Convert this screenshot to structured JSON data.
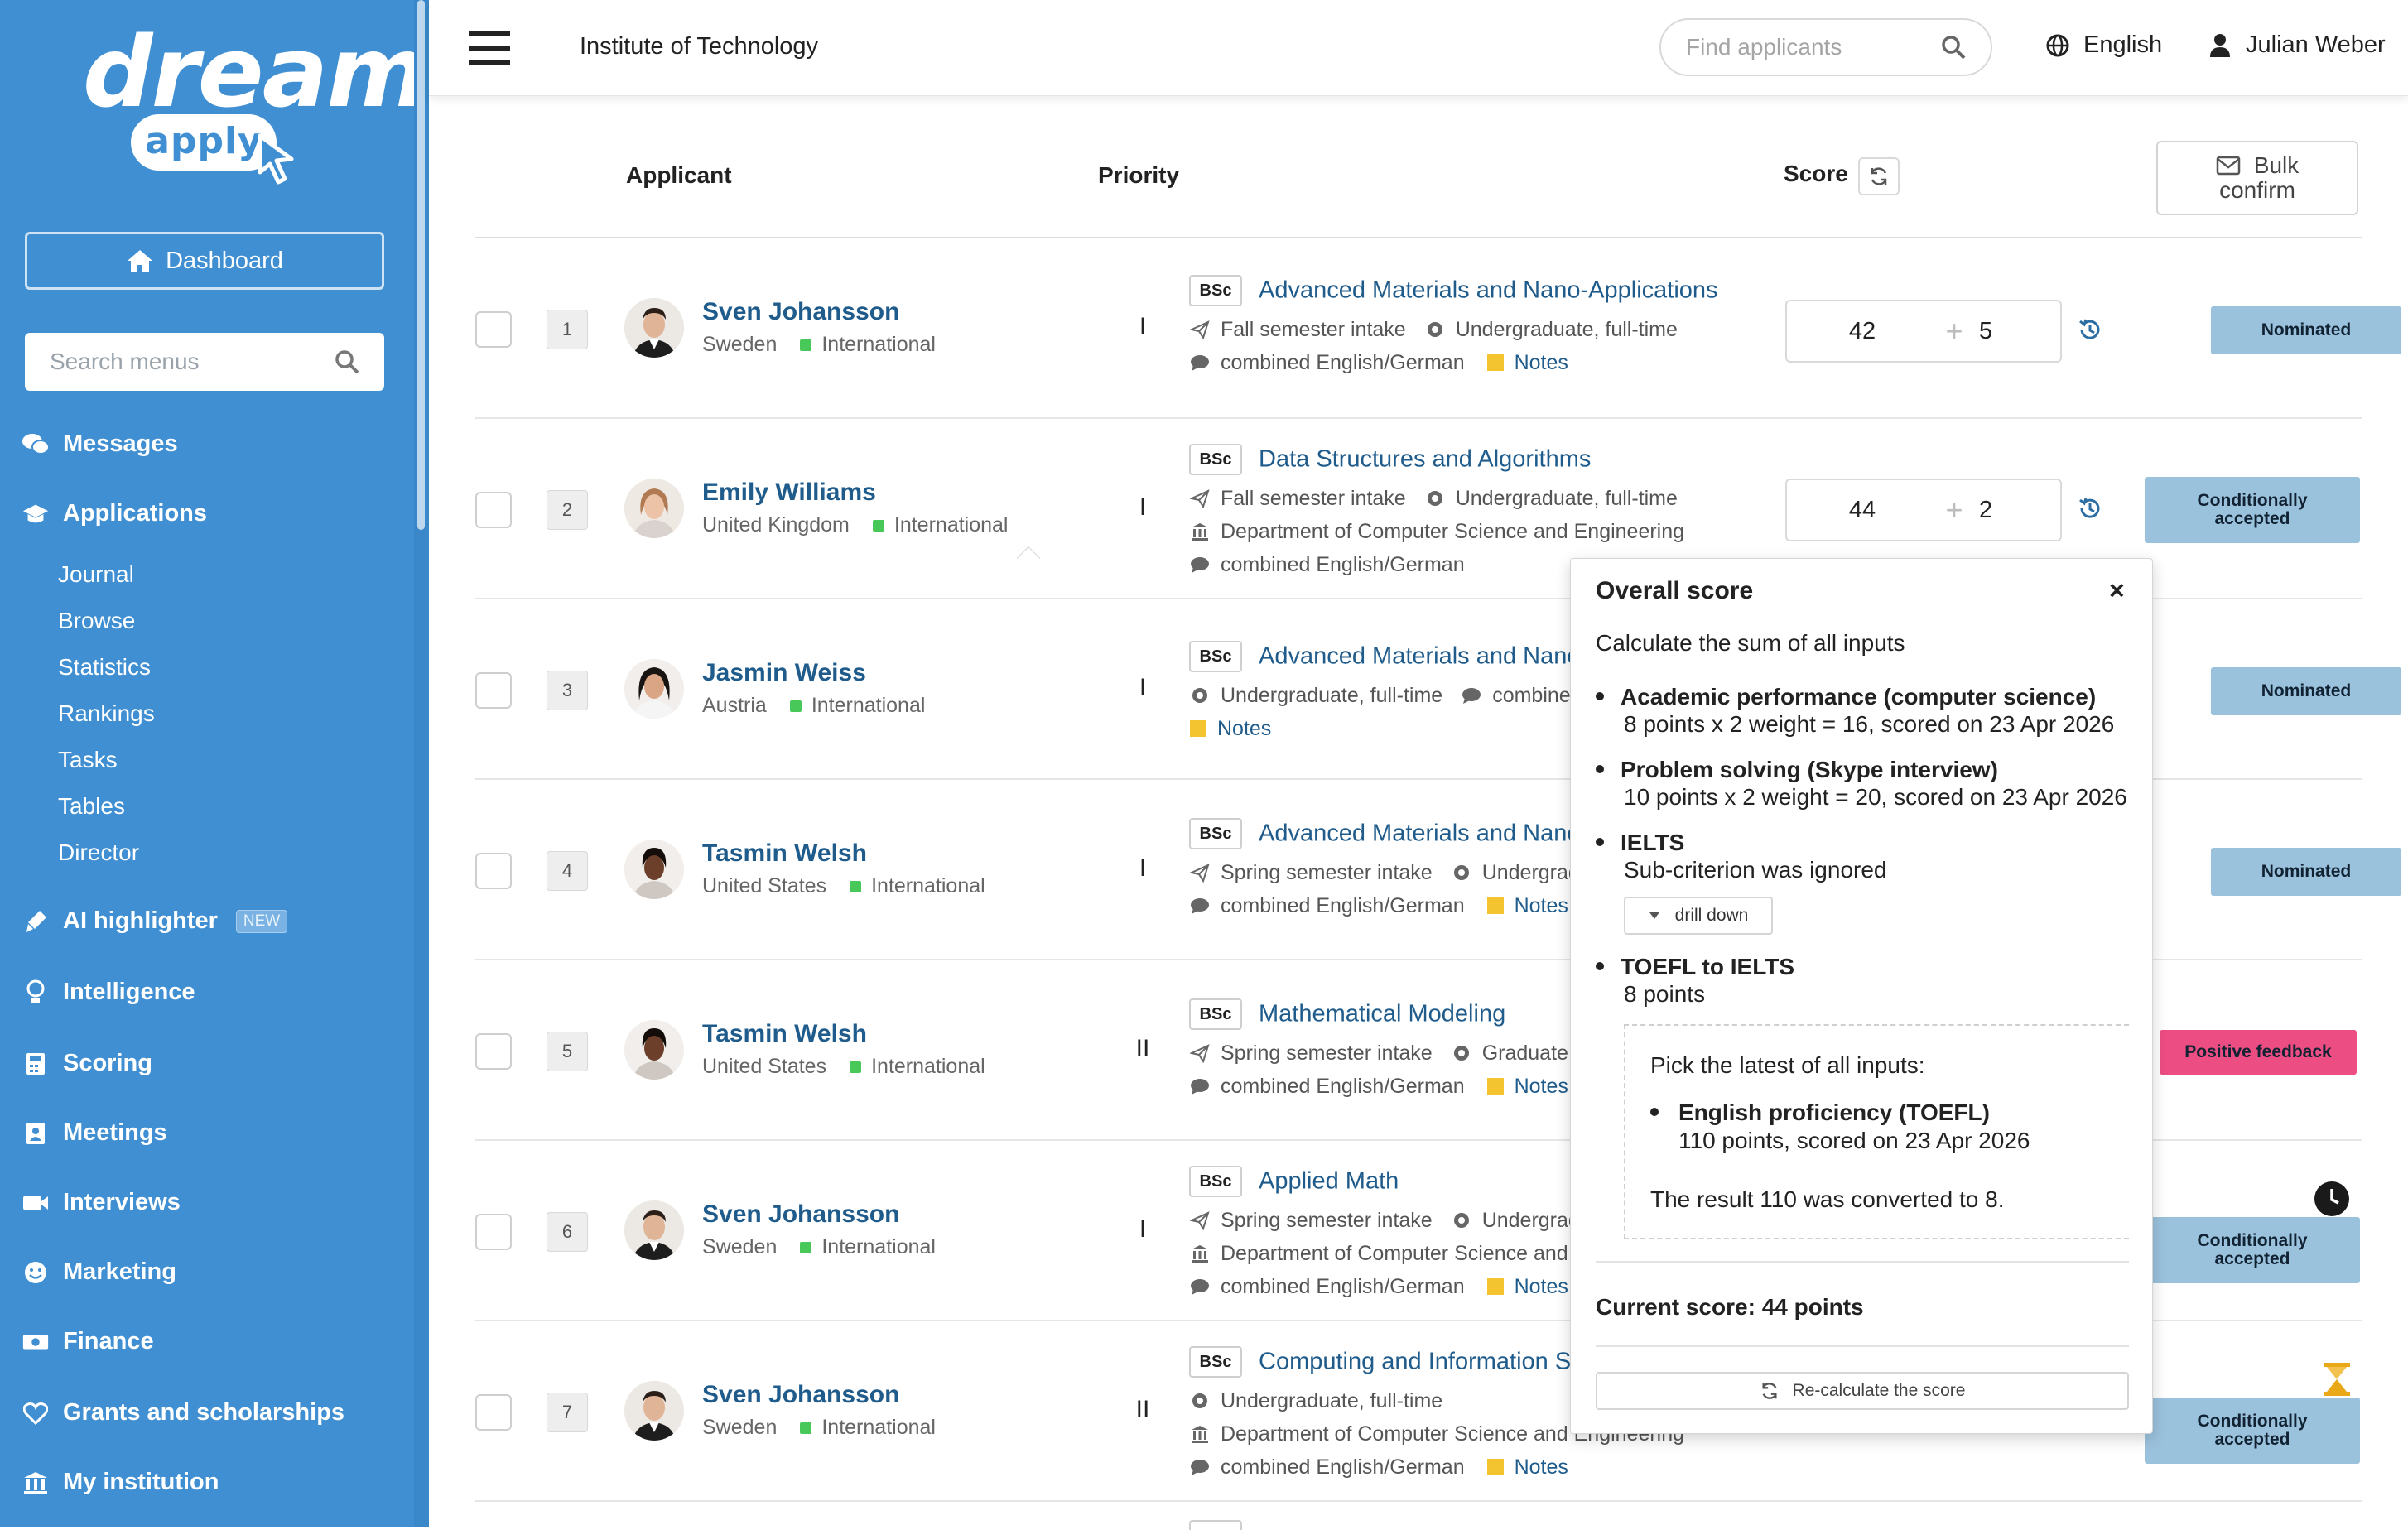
{
  "logo": {
    "top": "dream",
    "bottom": "apply"
  },
  "sidebar": {
    "dashboard": "Dashboard",
    "search_placeholder": "Search menus",
    "messages": "Messages",
    "applications": "Applications",
    "sub_items": [
      "Journal",
      "Browse",
      "Statistics",
      "Rankings",
      "Tasks",
      "Tables",
      "Director"
    ],
    "ai": "AI highlighter",
    "ai_badge": "NEW",
    "intelligence": "Intelligence",
    "scoring": "Scoring",
    "meetings": "Meetings",
    "interviews": "Interviews",
    "marketing": "Marketing",
    "finance": "Finance",
    "grants": "Grants and scholarships",
    "institution": "My institution"
  },
  "header": {
    "institution": "Institute of Technology",
    "search_placeholder": "Find applicants",
    "language": "English",
    "user": "Julian Weber"
  },
  "table": {
    "col_applicant": "Applicant",
    "col_priority": "Priority",
    "col_score": "Score",
    "bulk_line1": "Bulk",
    "bulk_line2": "confirm"
  },
  "rows": [
    {
      "n": "1",
      "name": "Sven Johansson",
      "country": "Sweden",
      "type": "International",
      "prio": "I",
      "level": "BSc",
      "program": "Advanced Materials and Nano-Applications",
      "l1a": "Fall semester intake",
      "l1b": "Undergraduate, full-time",
      "dept": "",
      "lang": "combined English/German",
      "notes": "Notes",
      "score1": "42",
      "score2": "5",
      "status": "Nominated"
    },
    {
      "n": "2",
      "name": "Emily Williams",
      "country": "United Kingdom",
      "type": "International",
      "prio": "I",
      "level": "BSc",
      "program": "Data Structures and Algorithms",
      "l1a": "Fall semester intake",
      "l1b": "Undergraduate, full-time",
      "dept": "Department of Computer Science and Engineering",
      "lang": "combined English/German",
      "notes": "",
      "score1": "44",
      "score2": "2",
      "status1": "Conditionally",
      "status2": "accepted"
    },
    {
      "n": "3",
      "name": "Jasmin Weiss",
      "country": "Austria",
      "type": "International",
      "prio": "I",
      "level": "BSc",
      "program": "Advanced Materials and Nano-",
      "l1a": "Undergraduate, full-time",
      "l1b": "combined",
      "notes": "Notes",
      "status": "Nominated"
    },
    {
      "n": "4",
      "name": "Tasmin Welsh",
      "country": "United States",
      "type": "International",
      "prio": "I",
      "level": "BSc",
      "program": "Advanced Materials and Nano-",
      "l1a": "Spring semester intake",
      "l1b": "Undergradu",
      "lang": "combined English/German",
      "notes": "Notes",
      "status": "Nominated"
    },
    {
      "n": "5",
      "name": "Tasmin Welsh",
      "country": "United States",
      "type": "International",
      "prio": "II",
      "level": "BSc",
      "program": "Mathematical Modeling",
      "l1a": "Spring semester intake",
      "l1b": "Graduate, fu",
      "lang": "combined English/German",
      "notes": "Notes",
      "status": "Positive feedback"
    },
    {
      "n": "6",
      "name": "Sven Johansson",
      "country": "Sweden",
      "type": "International",
      "prio": "I",
      "level": "BSc",
      "program": "Applied Math",
      "l1a": "Spring semester intake",
      "l1b": "Undergradu",
      "dept": "Department of Computer Science and E",
      "lang": "combined English/German",
      "notes": "Notes",
      "status1": "Conditionally",
      "status2": "accepted"
    },
    {
      "n": "7",
      "name": "Sven Johansson",
      "country": "Sweden",
      "type": "International",
      "prio": "II",
      "level": "BSc",
      "program": "Computing and Information Sy",
      "l1a": "Undergraduate, full-time",
      "dept": "Department of Computer Science and Engineering",
      "lang": "combined English/German",
      "notes": "Notes",
      "status1": "Conditionally",
      "status2": "accepted"
    }
  ],
  "popup": {
    "title": "Overall score",
    "close": "×",
    "calc": "Calculate the sum of all inputs",
    "items": [
      {
        "t": "Academic performance (computer science)",
        "d": "8 points x 2 weight = 16, scored on 23 Apr 2026"
      },
      {
        "t": "Problem solving (Skype interview)",
        "d": "10 points x 2 weight = 20, scored on 23 Apr 2026"
      },
      {
        "t": "IELTS",
        "d": "Sub-criterion was ignored"
      },
      {
        "t": "TOEFL to IELTS",
        "d": "8 points"
      }
    ],
    "drill": "drill down",
    "pick": "Pick the latest of all inputs:",
    "sub_t": "English proficiency (TOEFL)",
    "sub_d": "110 points, scored on 23 Apr 2026",
    "converted": "The result 110 was converted to 8.",
    "current": "Current score: 44 points",
    "recalc": "Re-calculate the score"
  },
  "colors": {
    "sidebar": "#3f8fd2",
    "link": "#1f5c8c",
    "nominated": "#9bc2dd",
    "positive": "#ec4d82"
  }
}
